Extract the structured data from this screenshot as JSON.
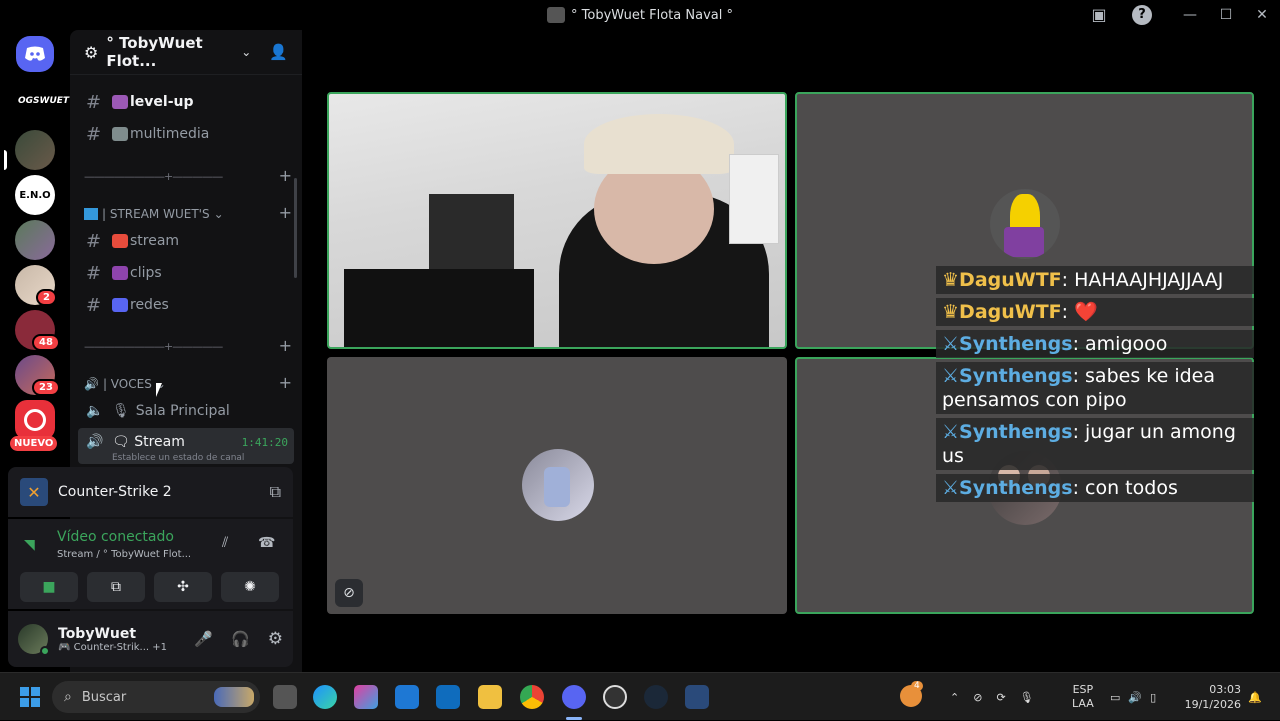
{
  "window": {
    "title": "° TobyWuet Flota Naval °"
  },
  "rail": {
    "servers": [
      {
        "name": "OGSWUET",
        "badge": null
      },
      {
        "name": "server-2",
        "badge": null
      },
      {
        "name": "E.N.O",
        "badge": null
      },
      {
        "name": "server-4",
        "badge": null
      },
      {
        "name": "server-5",
        "badge": "2"
      },
      {
        "name": "server-6",
        "badge": "48"
      },
      {
        "name": "server-7",
        "badge": "23"
      },
      {
        "name": "server-8",
        "badge": null
      }
    ],
    "new_label": "NUEVO"
  },
  "sidebar": {
    "server_name": "° TobyWuet Flot...",
    "channels_top": [
      {
        "label": "level-up"
      },
      {
        "label": "multimedia"
      }
    ],
    "separator": "————————+—————",
    "category_stream": "| STREAM WUET'S",
    "channels_stream": [
      {
        "label": "stream"
      },
      {
        "label": "clips"
      },
      {
        "label": "redes"
      }
    ],
    "category_voices": "| VOCES",
    "voice_channels": [
      {
        "label": "Sala Principal"
      },
      {
        "label": "Stream",
        "timer": "1:41:20",
        "status": "Establece un estado de canal"
      }
    ]
  },
  "game": {
    "name": "Counter-Strike 2"
  },
  "voice": {
    "status": "Vídeo conectado",
    "location": "Stream / ° TobyWuet Flot..."
  },
  "user": {
    "name": "TobyWuet",
    "activity": "Counter-Strik...",
    "extra": "+1"
  },
  "chat": [
    {
      "user": "DaguWTF",
      "message": "HAHAAJHJAJJAAJ",
      "role": "crown"
    },
    {
      "user": "DaguWTF",
      "message": "❤️",
      "role": "crown"
    },
    {
      "user": "Synthengs",
      "message": "amigooo",
      "role": "sword"
    },
    {
      "user": "Synthengs",
      "message": "sabes ke idea pensamos con pipo",
      "role": "sword"
    },
    {
      "user": "Synthengs",
      "message": "jugar un among us",
      "role": "sword"
    },
    {
      "user": "Synthengs",
      "message": "con todos",
      "role": "sword"
    }
  ],
  "taskbar": {
    "search_placeholder": "Buscar",
    "lang_top": "ESP",
    "lang_bottom": "LAA",
    "time": "03:03",
    "date": "19/1/2026",
    "weather_badge": "4"
  },
  "colors": {
    "accent_green": "#3ba55c",
    "username_gold": "#f0c04a",
    "username_blue": "#5dade2"
  }
}
